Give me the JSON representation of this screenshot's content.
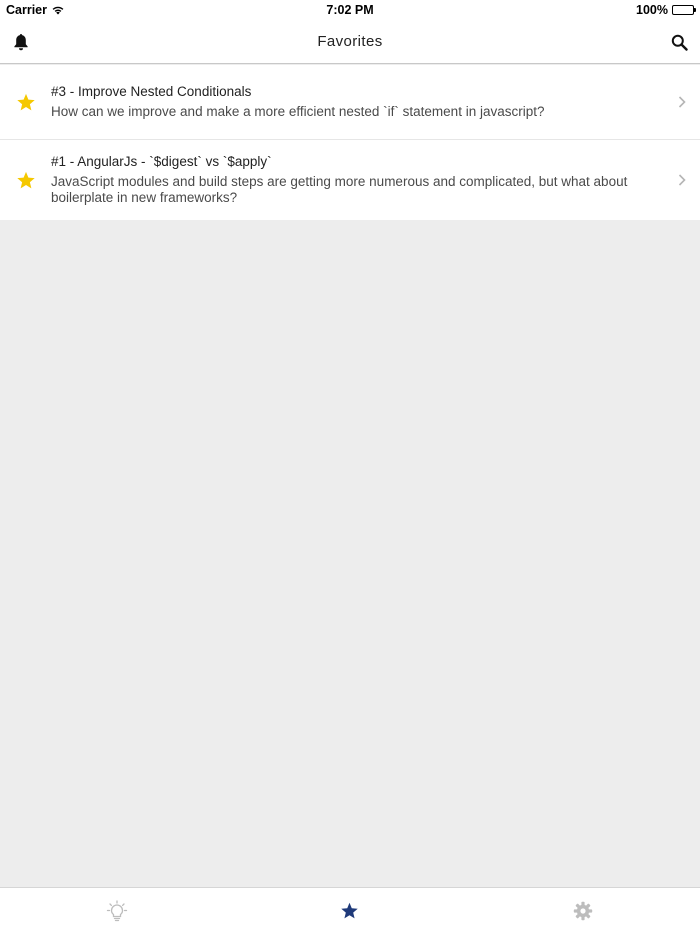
{
  "status_bar": {
    "carrier": "Carrier",
    "time": "7:02 PM",
    "battery": "100%"
  },
  "nav": {
    "title": "Favorites",
    "left_icon": "bell-icon",
    "right_icon": "search-icon"
  },
  "favorites": [
    {
      "title": "#3 - Improve Nested Conditionals",
      "description": "How can we improve and make a more efficient nested `if` statement in javascript?"
    },
    {
      "title": "#1 - AngularJs - `$digest` vs `$apply`",
      "description": "JavaScript modules and build steps are getting more numerous and complicated, but what about boilerplate in new frameworks?"
    }
  ],
  "tab_bar": {
    "tabs": [
      {
        "icon": "lightbulb-icon",
        "active": false
      },
      {
        "icon": "star-icon",
        "active": true
      },
      {
        "icon": "gear-icon",
        "active": false
      }
    ]
  },
  "colors": {
    "star": "#f5c800",
    "active_tab": "#1f3a7a",
    "inactive_tab": "#bdbdbd",
    "background": "#ededed"
  }
}
